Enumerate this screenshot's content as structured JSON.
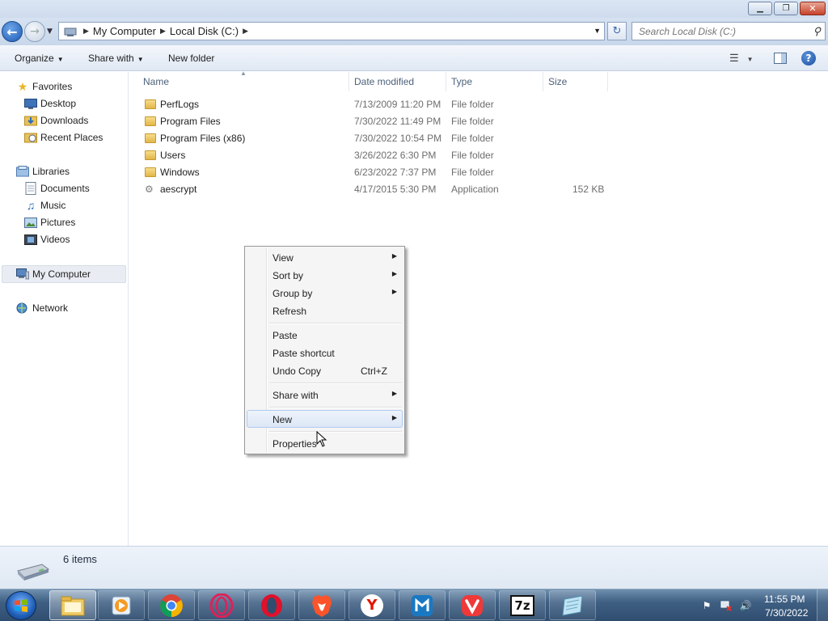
{
  "window": {
    "min_glyph": "▁",
    "max_glyph": "❐",
    "close_glyph": "✕"
  },
  "address": {
    "crumbs": [
      "My Computer",
      "Local Disk (C:)"
    ],
    "search_placeholder": "Search Local Disk (C:)"
  },
  "toolbar": {
    "organize": "Organize",
    "share_with": "Share with",
    "new_folder": "New folder"
  },
  "nav": {
    "favorites": "Favorites",
    "desktop": "Desktop",
    "downloads": "Downloads",
    "recent_places": "Recent Places",
    "libraries": "Libraries",
    "documents": "Documents",
    "music": "Music",
    "pictures": "Pictures",
    "videos": "Videos",
    "my_computer": "My Computer",
    "network": "Network"
  },
  "columns": {
    "name": "Name",
    "date_modified": "Date modified",
    "type": "Type",
    "size": "Size"
  },
  "files": [
    {
      "name": "PerfLogs",
      "date": "7/13/2009 11:20 PM",
      "type": "File folder",
      "size": "",
      "icon": "folder-icon"
    },
    {
      "name": "Program Files",
      "date": "7/30/2022 11:49 PM",
      "type": "File folder",
      "size": "",
      "icon": "folder-icon"
    },
    {
      "name": "Program Files (x86)",
      "date": "7/30/2022 10:54 PM",
      "type": "File folder",
      "size": "",
      "icon": "folder-icon"
    },
    {
      "name": "Users",
      "date": "3/26/2022 6:30 PM",
      "type": "File folder",
      "size": "",
      "icon": "folder-icon"
    },
    {
      "name": "Windows",
      "date": "6/23/2022 7:37 PM",
      "type": "File folder",
      "size": "",
      "icon": "folder-icon"
    },
    {
      "name": "aescrypt",
      "date": "4/17/2015 5:30 PM",
      "type": "Application",
      "size": "152 KB",
      "icon": "application-icon"
    }
  ],
  "context_menu": {
    "view": "View",
    "sort_by": "Sort by",
    "group_by": "Group by",
    "refresh": "Refresh",
    "paste": "Paste",
    "paste_shortcut": "Paste shortcut",
    "undo_copy": "Undo Copy",
    "undo_copy_shortcut": "Ctrl+Z",
    "share_with": "Share with",
    "new": "New",
    "properties": "Properties",
    "highlighted_item": "New"
  },
  "details": {
    "item_count": "6 items"
  },
  "taskbar": {
    "apps": [
      "Windows Explorer",
      "Media Player",
      "Chrome",
      "Opera GX",
      "Opera",
      "Brave",
      "Yandex",
      "Maxthon",
      "Vivaldi",
      "7-Zip",
      "Notepad"
    ],
    "seven_zip_label": "7z",
    "clock_time": "11:55 PM",
    "clock_date": "7/30/2022"
  },
  "colors": {
    "accent": "#1c5bb5",
    "menu_highlight": "#dce7f6",
    "chrome_red": "#db4437",
    "opera_red": "#e0112b",
    "brave_orange": "#fb542b",
    "yandex_red": "#e61400",
    "maxthon_blue": "#1a78c2",
    "vivaldi_red": "#ef3939"
  }
}
